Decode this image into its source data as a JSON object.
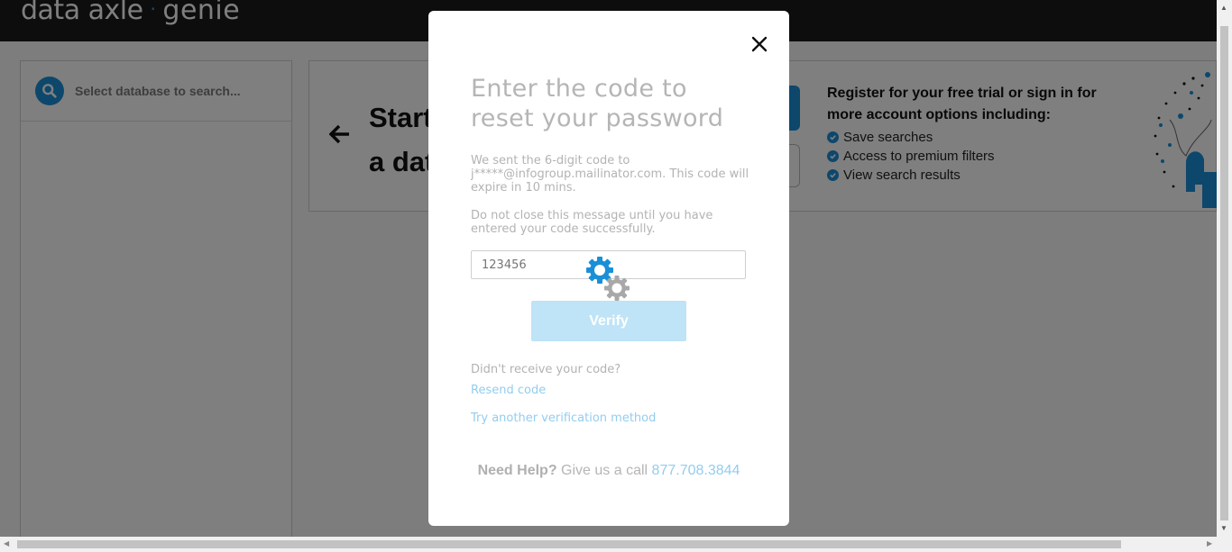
{
  "header": {
    "logo_primary": "data axle",
    "logo_separator": "·",
    "logo_secondary": "genie"
  },
  "sidebar": {
    "search_placeholder": "Select database to search..."
  },
  "banner": {
    "title_line1": "Start",
    "title_line2": "a dat",
    "register_title": "Register for your free trial or sign in for more account options including:",
    "perks": [
      "Save searches",
      "Access to premium filters",
      "View search results"
    ]
  },
  "modal": {
    "title": "Enter the code to reset your password",
    "sent_message": "We sent the 6-digit code to j*****@infogroup.mailinator.com. This code will expire in 10 mins.",
    "warning_message": "Do not close this message until you have entered your code successfully.",
    "code_placeholder": "123456",
    "verify_label": "Verify",
    "not_received": "Didn't receive your code?",
    "resend_label": "Resend code",
    "try_another_label": "Try another verification method",
    "help_prefix": "Need Help?",
    "help_text": "Give us a call",
    "help_phone": "877.708.3844"
  },
  "colors": {
    "brand_blue": "#1a8fd8",
    "header_bg": "#1a1a1a"
  }
}
